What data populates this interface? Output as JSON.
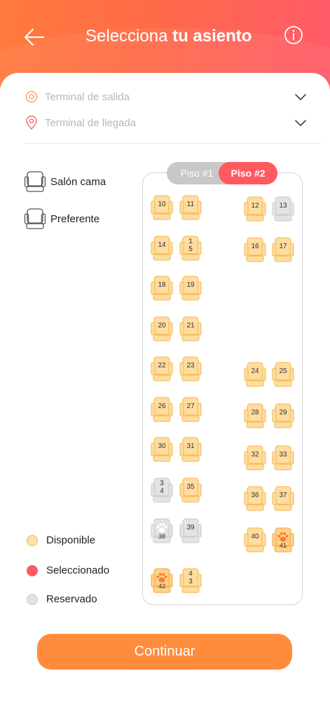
{
  "header": {
    "title_regular": "Selecciona",
    "title_bold": "tu asiento"
  },
  "filters": {
    "departure_label": "Terminal de salida",
    "arrival_label": "Terminal de llegada"
  },
  "seat_types": [
    {
      "label": "Salón cama"
    },
    {
      "label": "Preferente"
    }
  ],
  "floors": {
    "floor1_label": "Piso #1",
    "floor2_label": "Piso #2",
    "active": "Piso #2"
  },
  "status_legend": [
    {
      "label": "Disponible",
      "color": "#ffe1a8",
      "border": "#f0b84a"
    },
    {
      "label": "Seleccionado",
      "color": "#ff5a5f",
      "border": "#ff5a5f"
    },
    {
      "label": "Reservado",
      "color": "#e2e2e2",
      "border": "#cfcfcf"
    }
  ],
  "seat_colors": {
    "available": {
      "fill": "#ffdca0",
      "stroke": "#f0b84a"
    },
    "reserved": {
      "fill": "#e3e3e3",
      "stroke": "#c9c9c9"
    },
    "pet": {
      "fill": "#ffd18a",
      "stroke": "#f0a640",
      "paw": "#ff7a2e"
    }
  },
  "seats": [
    {
      "number": "10",
      "status": "available"
    },
    {
      "number": "11",
      "status": "available"
    },
    {
      "number": "12",
      "status": "available"
    },
    {
      "number": "13",
      "status": "reserved"
    },
    {
      "number": "14",
      "status": "available"
    },
    {
      "number": "15",
      "status": "available",
      "display": "1\n5"
    },
    {
      "number": "16",
      "status": "available"
    },
    {
      "number": "17",
      "status": "available"
    },
    {
      "number": "18",
      "status": "available"
    },
    {
      "number": "19",
      "status": "available"
    },
    {
      "number": "20",
      "status": "available"
    },
    {
      "number": "21",
      "status": "available"
    },
    {
      "number": "22",
      "status": "available"
    },
    {
      "number": "23",
      "status": "available"
    },
    {
      "number": "24",
      "status": "available"
    },
    {
      "number": "25",
      "status": "available"
    },
    {
      "number": "26",
      "status": "available"
    },
    {
      "number": "27",
      "status": "available"
    },
    {
      "number": "28",
      "status": "available"
    },
    {
      "number": "29",
      "status": "available"
    },
    {
      "number": "30",
      "status": "available"
    },
    {
      "number": "31",
      "status": "available"
    },
    {
      "number": "32",
      "status": "available"
    },
    {
      "number": "33",
      "status": "available"
    },
    {
      "number": "34",
      "status": "reserved",
      "display": "3\n4"
    },
    {
      "number": "35",
      "status": "available"
    },
    {
      "number": "36",
      "status": "available"
    },
    {
      "number": "37",
      "status": "available"
    },
    {
      "number": "38",
      "status": "reserved-pet"
    },
    {
      "number": "39",
      "status": "reserved"
    },
    {
      "number": "40",
      "status": "available"
    },
    {
      "number": "41",
      "status": "pet"
    },
    {
      "number": "42",
      "status": "pet"
    },
    {
      "number": "43",
      "status": "available",
      "display": "4\n3"
    }
  ],
  "continue_label": "Continuar"
}
